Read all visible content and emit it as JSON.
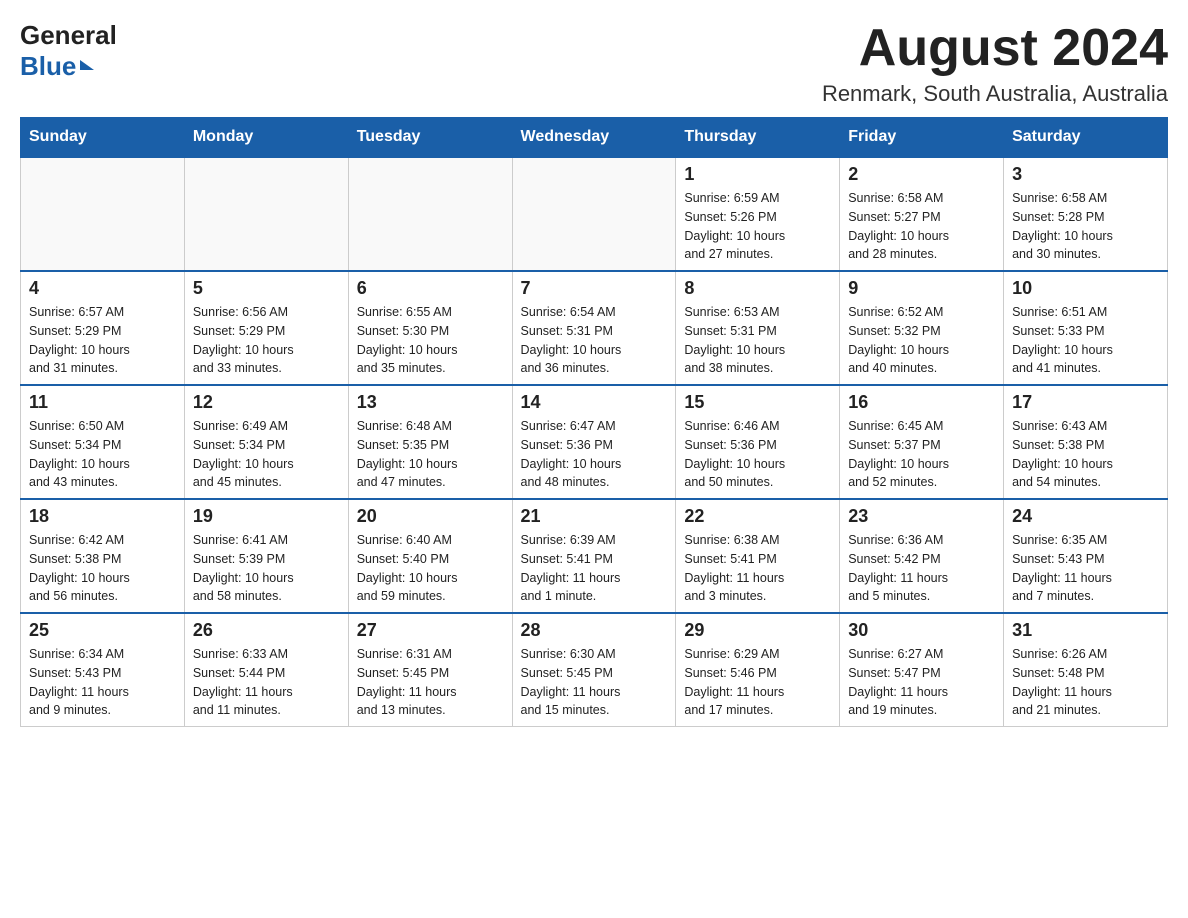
{
  "header": {
    "logo_line1": "General",
    "logo_line2": "Blue",
    "month_title": "August 2024",
    "location": "Renmark, South Australia, Australia"
  },
  "calendar": {
    "days_of_week": [
      "Sunday",
      "Monday",
      "Tuesday",
      "Wednesday",
      "Thursday",
      "Friday",
      "Saturday"
    ],
    "weeks": [
      [
        {
          "day": "",
          "info": ""
        },
        {
          "day": "",
          "info": ""
        },
        {
          "day": "",
          "info": ""
        },
        {
          "day": "",
          "info": ""
        },
        {
          "day": "1",
          "info": "Sunrise: 6:59 AM\nSunset: 5:26 PM\nDaylight: 10 hours\nand 27 minutes."
        },
        {
          "day": "2",
          "info": "Sunrise: 6:58 AM\nSunset: 5:27 PM\nDaylight: 10 hours\nand 28 minutes."
        },
        {
          "day": "3",
          "info": "Sunrise: 6:58 AM\nSunset: 5:28 PM\nDaylight: 10 hours\nand 30 minutes."
        }
      ],
      [
        {
          "day": "4",
          "info": "Sunrise: 6:57 AM\nSunset: 5:29 PM\nDaylight: 10 hours\nand 31 minutes."
        },
        {
          "day": "5",
          "info": "Sunrise: 6:56 AM\nSunset: 5:29 PM\nDaylight: 10 hours\nand 33 minutes."
        },
        {
          "day": "6",
          "info": "Sunrise: 6:55 AM\nSunset: 5:30 PM\nDaylight: 10 hours\nand 35 minutes."
        },
        {
          "day": "7",
          "info": "Sunrise: 6:54 AM\nSunset: 5:31 PM\nDaylight: 10 hours\nand 36 minutes."
        },
        {
          "day": "8",
          "info": "Sunrise: 6:53 AM\nSunset: 5:31 PM\nDaylight: 10 hours\nand 38 minutes."
        },
        {
          "day": "9",
          "info": "Sunrise: 6:52 AM\nSunset: 5:32 PM\nDaylight: 10 hours\nand 40 minutes."
        },
        {
          "day": "10",
          "info": "Sunrise: 6:51 AM\nSunset: 5:33 PM\nDaylight: 10 hours\nand 41 minutes."
        }
      ],
      [
        {
          "day": "11",
          "info": "Sunrise: 6:50 AM\nSunset: 5:34 PM\nDaylight: 10 hours\nand 43 minutes."
        },
        {
          "day": "12",
          "info": "Sunrise: 6:49 AM\nSunset: 5:34 PM\nDaylight: 10 hours\nand 45 minutes."
        },
        {
          "day": "13",
          "info": "Sunrise: 6:48 AM\nSunset: 5:35 PM\nDaylight: 10 hours\nand 47 minutes."
        },
        {
          "day": "14",
          "info": "Sunrise: 6:47 AM\nSunset: 5:36 PM\nDaylight: 10 hours\nand 48 minutes."
        },
        {
          "day": "15",
          "info": "Sunrise: 6:46 AM\nSunset: 5:36 PM\nDaylight: 10 hours\nand 50 minutes."
        },
        {
          "day": "16",
          "info": "Sunrise: 6:45 AM\nSunset: 5:37 PM\nDaylight: 10 hours\nand 52 minutes."
        },
        {
          "day": "17",
          "info": "Sunrise: 6:43 AM\nSunset: 5:38 PM\nDaylight: 10 hours\nand 54 minutes."
        }
      ],
      [
        {
          "day": "18",
          "info": "Sunrise: 6:42 AM\nSunset: 5:38 PM\nDaylight: 10 hours\nand 56 minutes."
        },
        {
          "day": "19",
          "info": "Sunrise: 6:41 AM\nSunset: 5:39 PM\nDaylight: 10 hours\nand 58 minutes."
        },
        {
          "day": "20",
          "info": "Sunrise: 6:40 AM\nSunset: 5:40 PM\nDaylight: 10 hours\nand 59 minutes."
        },
        {
          "day": "21",
          "info": "Sunrise: 6:39 AM\nSunset: 5:41 PM\nDaylight: 11 hours\nand 1 minute."
        },
        {
          "day": "22",
          "info": "Sunrise: 6:38 AM\nSunset: 5:41 PM\nDaylight: 11 hours\nand 3 minutes."
        },
        {
          "day": "23",
          "info": "Sunrise: 6:36 AM\nSunset: 5:42 PM\nDaylight: 11 hours\nand 5 minutes."
        },
        {
          "day": "24",
          "info": "Sunrise: 6:35 AM\nSunset: 5:43 PM\nDaylight: 11 hours\nand 7 minutes."
        }
      ],
      [
        {
          "day": "25",
          "info": "Sunrise: 6:34 AM\nSunset: 5:43 PM\nDaylight: 11 hours\nand 9 minutes."
        },
        {
          "day": "26",
          "info": "Sunrise: 6:33 AM\nSunset: 5:44 PM\nDaylight: 11 hours\nand 11 minutes."
        },
        {
          "day": "27",
          "info": "Sunrise: 6:31 AM\nSunset: 5:45 PM\nDaylight: 11 hours\nand 13 minutes."
        },
        {
          "day": "28",
          "info": "Sunrise: 6:30 AM\nSunset: 5:45 PM\nDaylight: 11 hours\nand 15 minutes."
        },
        {
          "day": "29",
          "info": "Sunrise: 6:29 AM\nSunset: 5:46 PM\nDaylight: 11 hours\nand 17 minutes."
        },
        {
          "day": "30",
          "info": "Sunrise: 6:27 AM\nSunset: 5:47 PM\nDaylight: 11 hours\nand 19 minutes."
        },
        {
          "day": "31",
          "info": "Sunrise: 6:26 AM\nSunset: 5:48 PM\nDaylight: 11 hours\nand 21 minutes."
        }
      ]
    ]
  }
}
